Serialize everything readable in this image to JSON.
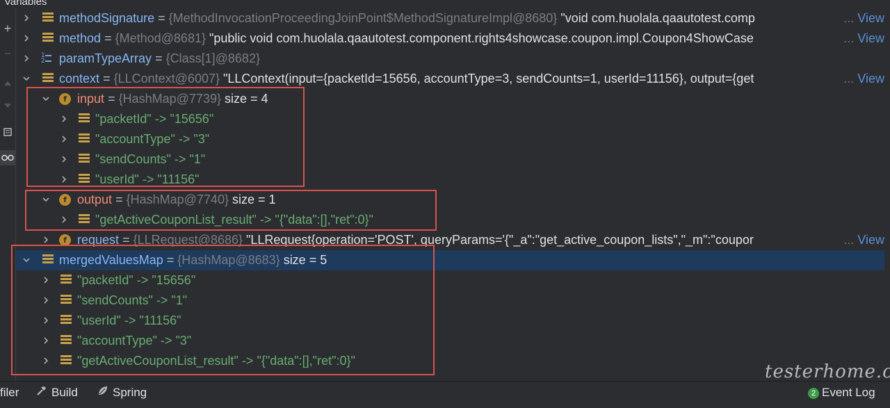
{
  "header": {
    "label": "Variables"
  },
  "gutter": {
    "icons": [
      "plus-icon",
      "minus-icon",
      "up-icon",
      "down-icon",
      "copy-icon",
      "glasses-icon"
    ]
  },
  "rows": [
    {
      "name": "methodSignature",
      "type": "{MethodInvocationProceedingJoinPoint$MethodSignatureImpl@8680}",
      "value": "\"void com.huolala.qaautotest.comp",
      "view": "View"
    },
    {
      "name": "method",
      "type": "{Method@8681}",
      "value": "\"public void com.huolala.qaautotest.component.rights4showcase.coupon.impl.Coupon4ShowCase",
      "view": "View"
    },
    {
      "name": "paramTypeArray",
      "type": "{Class[1]@8682}"
    },
    {
      "name": "context",
      "type": "{LLContext@6007}",
      "value": "\"LLContext(input={packetId=15656, accountType=3, sendCounts=1, userId=11156}, output={get",
      "view": "View"
    },
    {
      "name": "input",
      "type": "{HashMap@7739}",
      "size": "size = 4"
    },
    {
      "key": "\"packetId\"",
      "op": "->",
      "val": "\"15656\""
    },
    {
      "key": "\"accountType\"",
      "op": "->",
      "val": "\"3\""
    },
    {
      "key": "\"sendCounts\"",
      "op": "->",
      "val": "\"1\""
    },
    {
      "key": "\"userId\"",
      "op": "->",
      "val": "\"11156\""
    },
    {
      "name": "output",
      "type": "{HashMap@7740}",
      "size": "size = 1"
    },
    {
      "key": "\"getActiveCouponList_result\"",
      "op": "->",
      "val": "\"{\"data\":[],\"ret\":0}\""
    },
    {
      "name": "request",
      "type": "{LLRequest@8686}",
      "value": "\"LLRequest{operation='POST', queryParams='{\"_a\":\"get_active_coupon_lists\",\"_m\":\"coupor",
      "view": "View"
    },
    {
      "name": "mergedValuesMap",
      "type": "{HashMap@8683}",
      "size": "size = 5"
    },
    {
      "key": "\"packetId\"",
      "op": "->",
      "val": "\"15656\""
    },
    {
      "key": "\"sendCounts\"",
      "op": "->",
      "val": "\"1\""
    },
    {
      "key": "\"userId\"",
      "op": "->",
      "val": "\"11156\""
    },
    {
      "key": "\"accountType\"",
      "op": "->",
      "val": "\"3\""
    },
    {
      "key": "\"getActiveCouponList_result\"",
      "op": "->",
      "val": "\"{\"data\":[],\"ret\":0}\""
    }
  ],
  "eq": "=",
  "ellipsis": "...",
  "footer": {
    "profiler": "filer",
    "build": "Build",
    "spring": "Spring",
    "event_count": "2",
    "event_log": "Event Log"
  },
  "watermark": "testerhome.com",
  "colors": {
    "highlight_box": "#d9534f",
    "selected_row": "#1e3a5c",
    "name": "#88b6f2",
    "string": "#6aab73"
  }
}
